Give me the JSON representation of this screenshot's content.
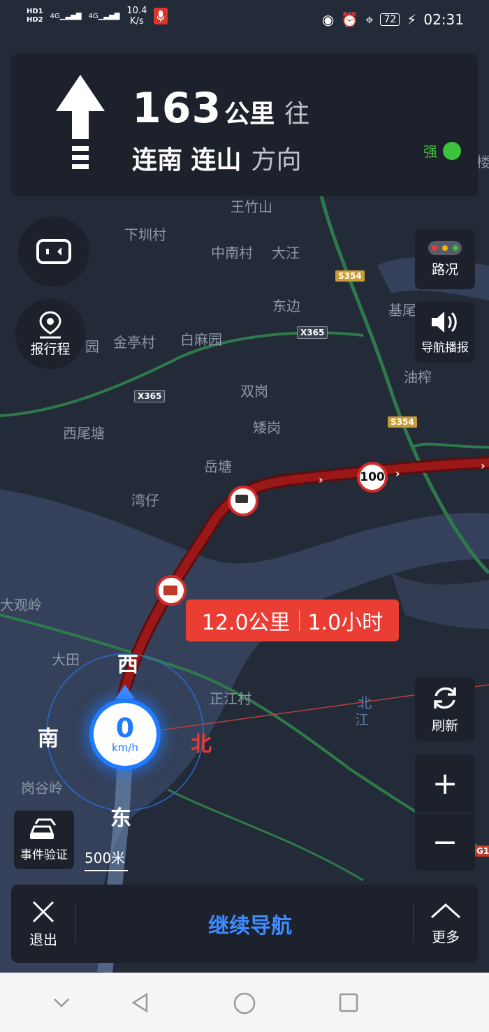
{
  "status_bar": {
    "hd1": "HD1",
    "hd2": "HD2",
    "signal1": "4G",
    "signal2": "4G",
    "net_speed_value": "10.4",
    "net_speed_unit": "K/s",
    "battery": "72",
    "time": "02:31"
  },
  "navigation_card": {
    "distance_value": "163",
    "distance_unit": "公里",
    "toward": "往",
    "roads": "连南 连山",
    "direction": "方向",
    "gps_strength": "强",
    "accent_color": "#3ec23e"
  },
  "left_buttons": {
    "report_trip": "报行程"
  },
  "right_buttons": {
    "traffic": "路况",
    "voice": "导航播报",
    "refresh": "刷新"
  },
  "map": {
    "labels": [
      "王竹山",
      "下圳村",
      "中南村",
      "大汪",
      "东边",
      "基尾",
      "金亭村",
      "白麻园",
      "双岗",
      "油榨",
      "西尾塘",
      "矮岗",
      "岳塘",
      "湾仔",
      "大观岭",
      "大田",
      "正江村",
      "北",
      "江",
      "岗谷岭",
      "楼",
      "园"
    ],
    "shields": [
      "S354",
      "X365",
      "X365",
      "S354",
      "G1"
    ],
    "speed_limit": "100",
    "route_color": "#8c1414"
  },
  "route_tip": {
    "distance": "12.0公里",
    "time": "1.0小时"
  },
  "compass": {
    "west": "西",
    "south": "南",
    "north": "北",
    "east": "东"
  },
  "speedometer": {
    "value": "0",
    "unit": "km/h"
  },
  "event_verify": "事件验证",
  "scale": "500米",
  "zoom": {
    "plus": "+",
    "minus": "−"
  },
  "bottom_bar": {
    "exit": "退出",
    "continue": "继续导航",
    "more": "更多"
  }
}
